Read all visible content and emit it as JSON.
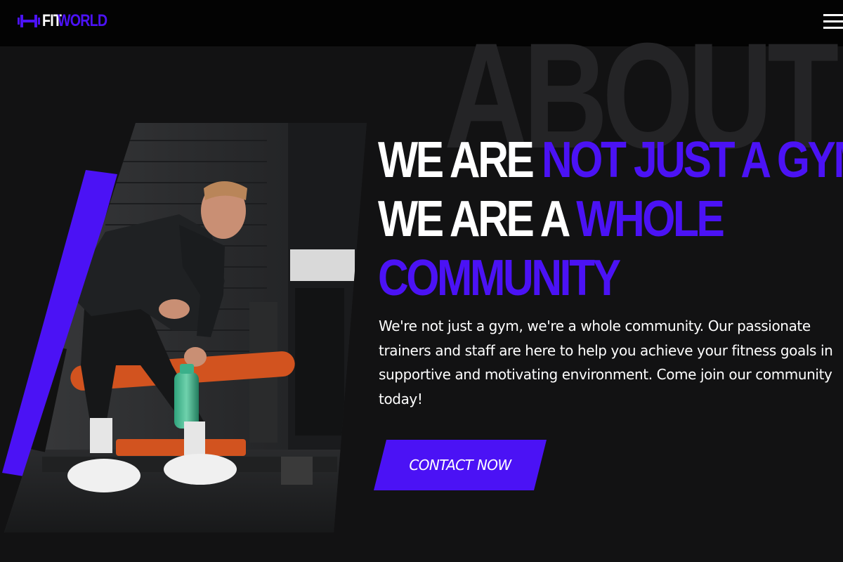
{
  "brand": {
    "name_part1": "FIT",
    "name_part2": "WORLD",
    "icon": "dumbbell-icon"
  },
  "nav": {
    "menu_icon": "hamburger-menu-icon"
  },
  "section": {
    "background_word": "ABOUT",
    "headline": {
      "line1_white": "WE ARE ",
      "line1_accent": "NOT JUST A GYM",
      "line1_tail": ",",
      "line2_white": "WE ARE A ",
      "line2_accent": "WHOLE",
      "line3_accent": "COMMUNITY"
    },
    "description_lines": [
      "We're not just a gym, we're a whole community. Our passionate",
      "trainers and staff are here to help you achieve your fitness goals in",
      "supportive and motivating environment. Come join our community",
      "today!"
    ],
    "cta_label": "CONTACT NOW"
  },
  "colors": {
    "accent": "#4b12f5",
    "background": "#121213",
    "navbar": "#030303",
    "text": "#ffffff"
  }
}
